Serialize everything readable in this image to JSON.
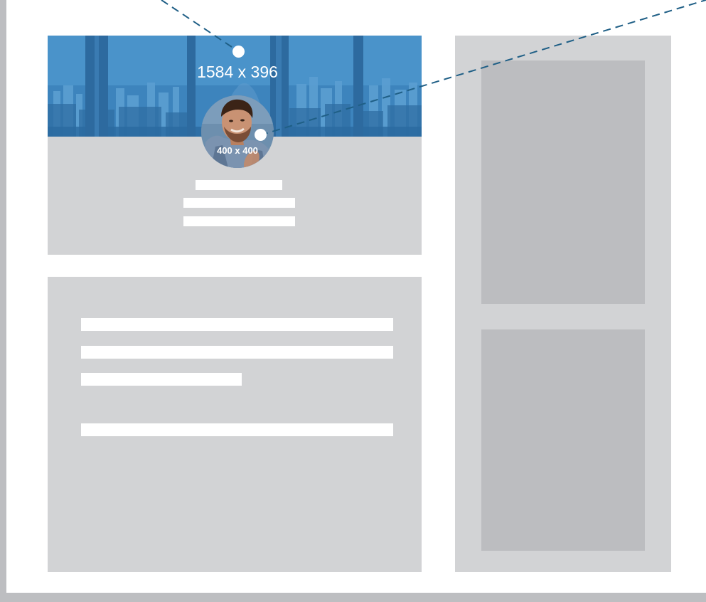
{
  "cover_photo": {
    "dimension_label": "1584 x 396",
    "tint_color": "#3f88c2"
  },
  "profile_photo": {
    "dimension_label": "400 x 400"
  },
  "callout_line_color": "#1f5f86",
  "placeholder_color": "#d2d3d5",
  "placeholder_block_color": "#bcbdc0",
  "placeholder_text_color": "#ffffff"
}
